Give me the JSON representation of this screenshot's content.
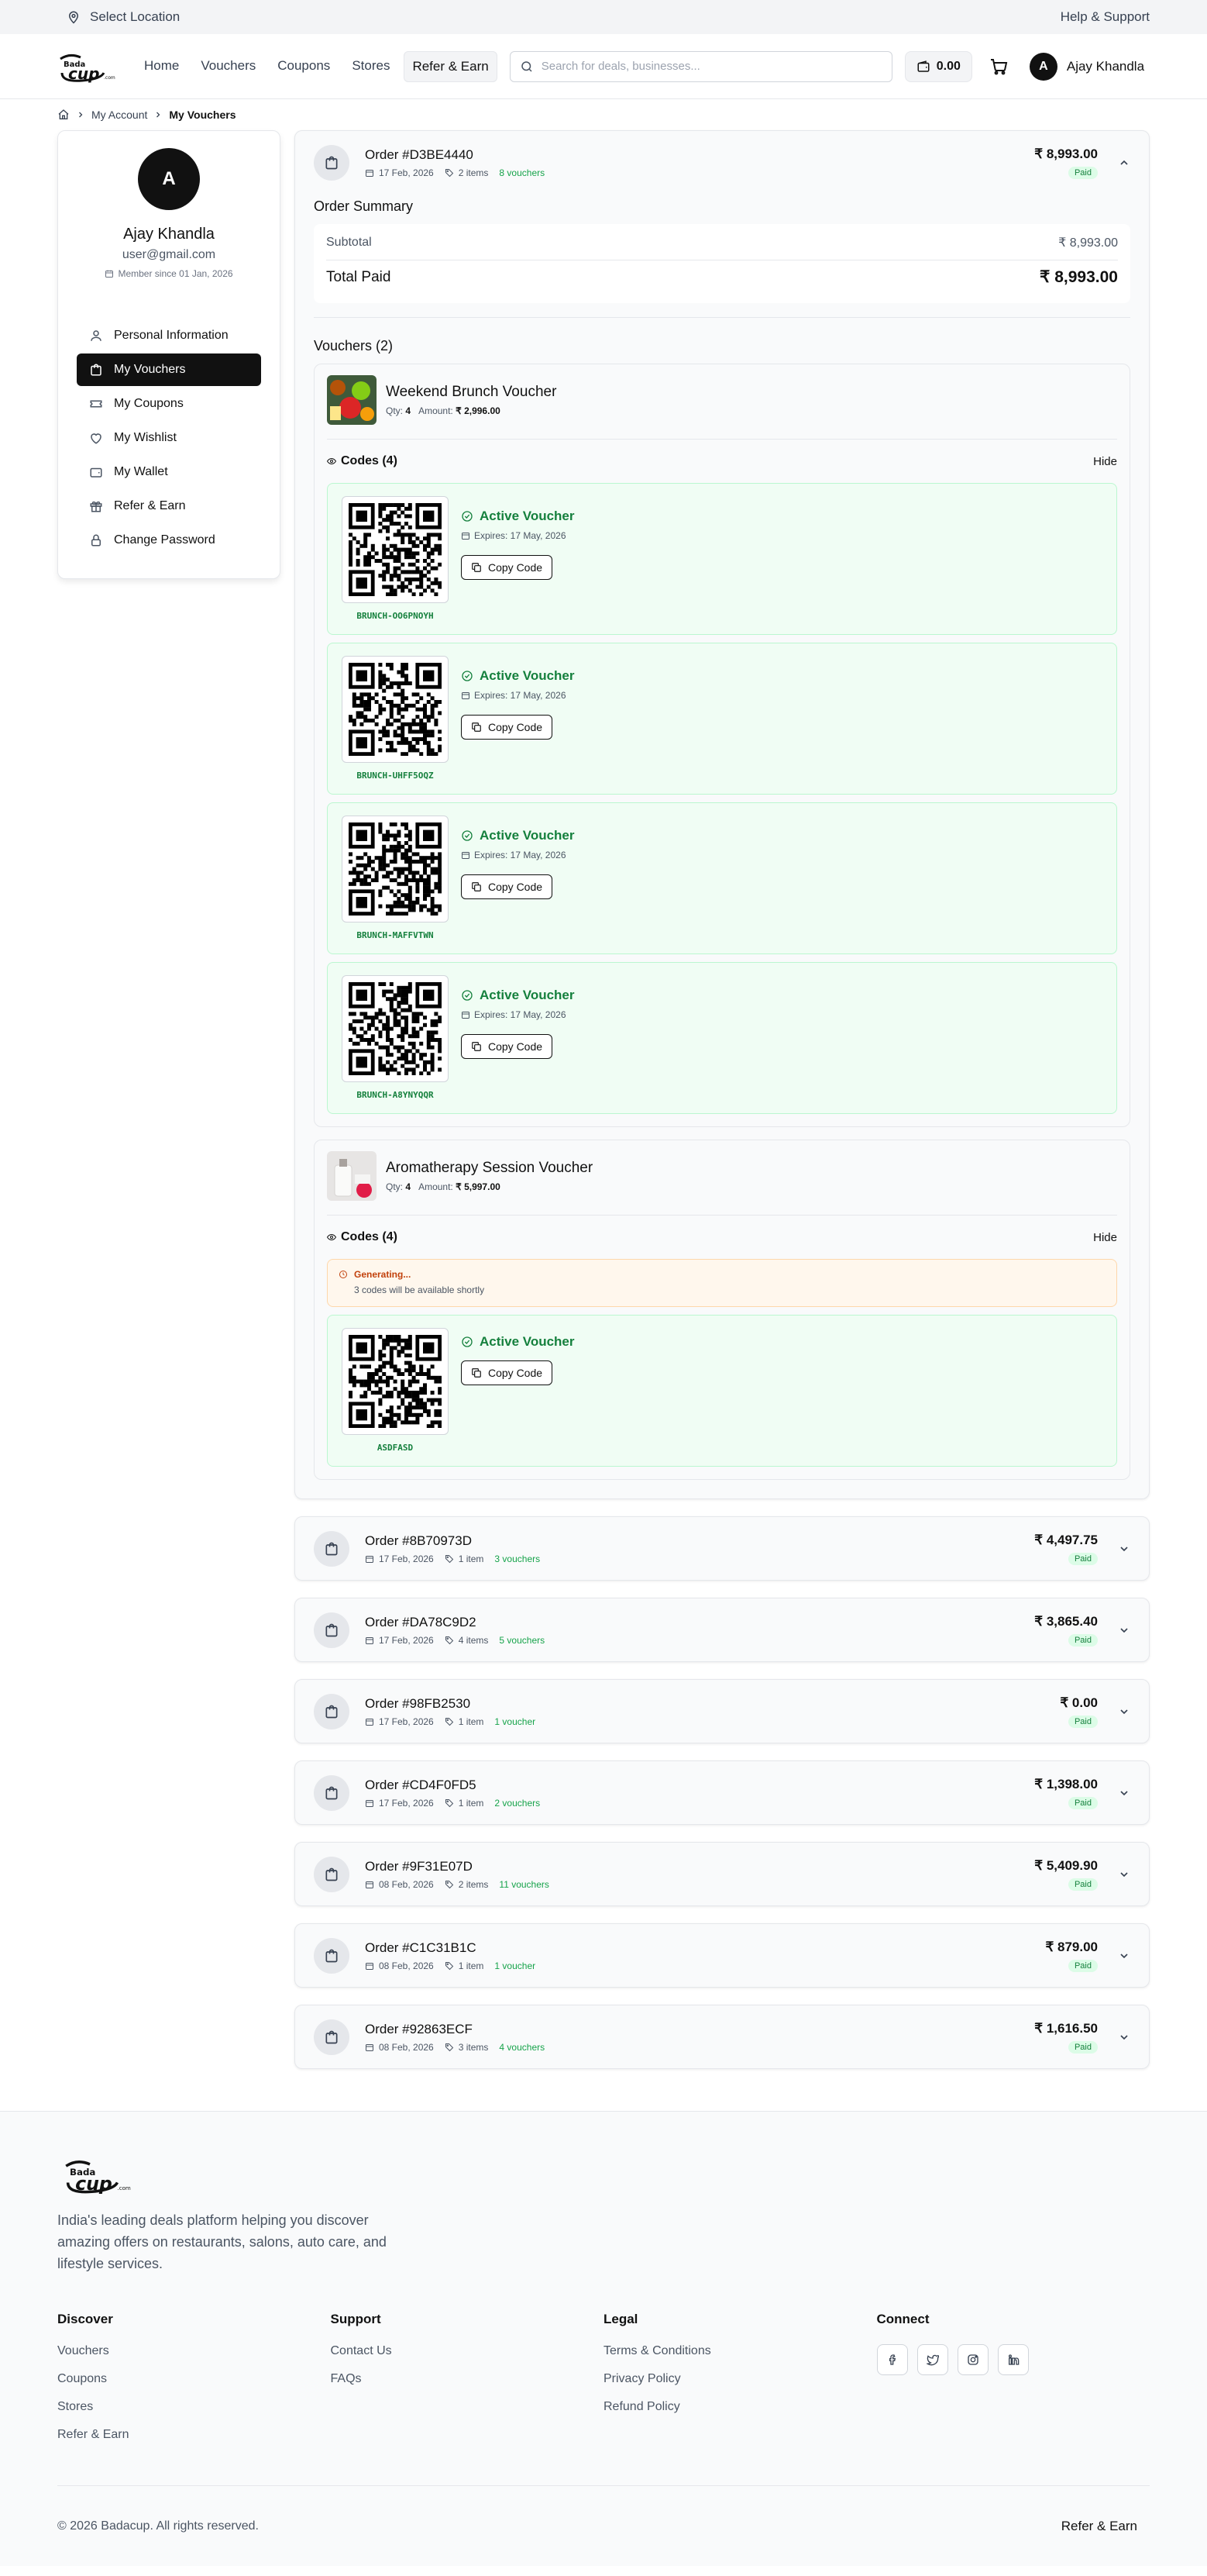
{
  "topbar": {
    "location": "Select Location",
    "help": "Help & Support"
  },
  "brand": {
    "logo_text": "Bada cup .com"
  },
  "nav": {
    "items": [
      {
        "label": "Home"
      },
      {
        "label": "Vouchers"
      },
      {
        "label": "Coupons"
      },
      {
        "label": "Stores"
      },
      {
        "label": "Refer & Earn",
        "active": true
      }
    ],
    "search_placeholder": "Search for deals, businesses...",
    "wallet_balance": "0.00",
    "user_initial": "A",
    "user_name": "Ajay Khandla"
  },
  "breadcrumb": {
    "account": "My Account",
    "current": "My Vouchers"
  },
  "profile": {
    "initial": "A",
    "name": "Ajay Khandla",
    "email": "user@gmail.com",
    "since": "Member since 01 Jan, 2026",
    "menu": [
      {
        "label": "Personal Information",
        "icon": "user-icon"
      },
      {
        "label": "My Vouchers",
        "icon": "bag-icon",
        "active": true
      },
      {
        "label": "My Coupons",
        "icon": "ticket-icon"
      },
      {
        "label": "My Wishlist",
        "icon": "heart-icon"
      },
      {
        "label": "My Wallet",
        "icon": "wallet-icon"
      },
      {
        "label": "Refer & Earn",
        "icon": "gift-icon"
      },
      {
        "label": "Change Password",
        "icon": "lock-icon"
      }
    ]
  },
  "expanded_order": {
    "id": "Order #D3BE4440",
    "date": "17 Feb, 2026",
    "items": "2 items",
    "vouchers": "8 vouchers",
    "amount": "₹ 8,993.00",
    "status": "Paid",
    "summary_title": "Order Summary",
    "subtotal_label": "Subtotal",
    "subtotal": "₹ 8,993.00",
    "total_label": "Total Paid",
    "total": "₹ 8,993.00",
    "vouchers_title": "Vouchers (2)",
    "voucher1": {
      "title": "Weekend Brunch Voucher",
      "qty_label": "Qty:",
      "qty": "4",
      "amount_label": "Amount:",
      "amount": "₹ 2,996.00",
      "codes_label": "Codes (4)",
      "hide": "Hide"
    },
    "voucher2": {
      "title": "Aromatherapy Session Voucher",
      "qty_label": "Qty:",
      "qty": "4",
      "amount_label": "Amount:",
      "amount": "₹ 5,997.00",
      "codes_label": "Codes (4)",
      "hide": "Hide",
      "generating_title": "Generating...",
      "generating_text": "3 codes will be available shortly"
    },
    "codes": [
      {
        "code": "BRUNCH-OO6PNOYH",
        "status": "Active Voucher",
        "expires": "Expires: 17 May, 2026",
        "copy": "Copy Code"
      },
      {
        "code": "BRUNCH-UHFF5OQZ",
        "status": "Active Voucher",
        "expires": "Expires: 17 May, 2026",
        "copy": "Copy Code"
      },
      {
        "code": "BRUNCH-MAFFVTWN",
        "status": "Active Voucher",
        "expires": "Expires: 17 May, 2026",
        "copy": "Copy Code"
      },
      {
        "code": "BRUNCH-A8YNYQQR",
        "status": "Active Voucher",
        "expires": "Expires: 17 May, 2026",
        "copy": "Copy Code"
      },
      {
        "code": "ASDFASD",
        "status": "Active Voucher",
        "copy": "Copy Code"
      }
    ]
  },
  "orders": [
    {
      "id": "Order #8B70973D",
      "date": "17 Feb, 2026",
      "items": "1 item",
      "vouchers": "3 vouchers",
      "amount": "₹ 4,497.75",
      "status": "Paid"
    },
    {
      "id": "Order #DA78C9D2",
      "date": "17 Feb, 2026",
      "items": "4 items",
      "vouchers": "5 vouchers",
      "amount": "₹ 3,865.40",
      "status": "Paid"
    },
    {
      "id": "Order #98FB2530",
      "date": "17 Feb, 2026",
      "items": "1 item",
      "vouchers": "1 voucher",
      "amount": "₹ 0.00",
      "status": "Paid"
    },
    {
      "id": "Order #CD4F0FD5",
      "date": "17 Feb, 2026",
      "items": "1 item",
      "vouchers": "2 vouchers",
      "amount": "₹ 1,398.00",
      "status": "Paid"
    },
    {
      "id": "Order #9F31E07D",
      "date": "08 Feb, 2026",
      "items": "2 items",
      "vouchers": "11 vouchers",
      "amount": "₹ 5,409.90",
      "status": "Paid"
    },
    {
      "id": "Order #C1C31B1C",
      "date": "08 Feb, 2026",
      "items": "1 item",
      "vouchers": "1 voucher",
      "amount": "₹ 879.00",
      "status": "Paid"
    },
    {
      "id": "Order #92863ECF",
      "date": "08 Feb, 2026",
      "items": "3 items",
      "vouchers": "4 vouchers",
      "amount": "₹ 1,616.50",
      "status": "Paid"
    }
  ],
  "footer": {
    "description": "India's leading deals platform helping you discover amazing offers on restaurants, salons, auto care, and lifestyle services.",
    "discover": {
      "title": "Discover",
      "links": [
        "Vouchers",
        "Coupons",
        "Stores",
        "Refer & Earn"
      ]
    },
    "support": {
      "title": "Support",
      "links": [
        "Contact Us",
        "FAQs"
      ]
    },
    "legal": {
      "title": "Legal",
      "links": [
        "Terms & Conditions",
        "Privacy Policy",
        "Refund Policy"
      ]
    },
    "connect": {
      "title": "Connect",
      "icons": [
        "facebook-icon",
        "twitter-icon",
        "instagram-icon",
        "linkedin-icon"
      ]
    },
    "copyright": "© 2026 Badacup. All rights reserved.",
    "bottom_link": "Refer & Earn"
  },
  "colors": {
    "accent": "#111111",
    "success": "#16a34a",
    "success_bg": "#f0fdf4",
    "warning": "#c2410c",
    "warning_bg": "#fff7ed"
  }
}
